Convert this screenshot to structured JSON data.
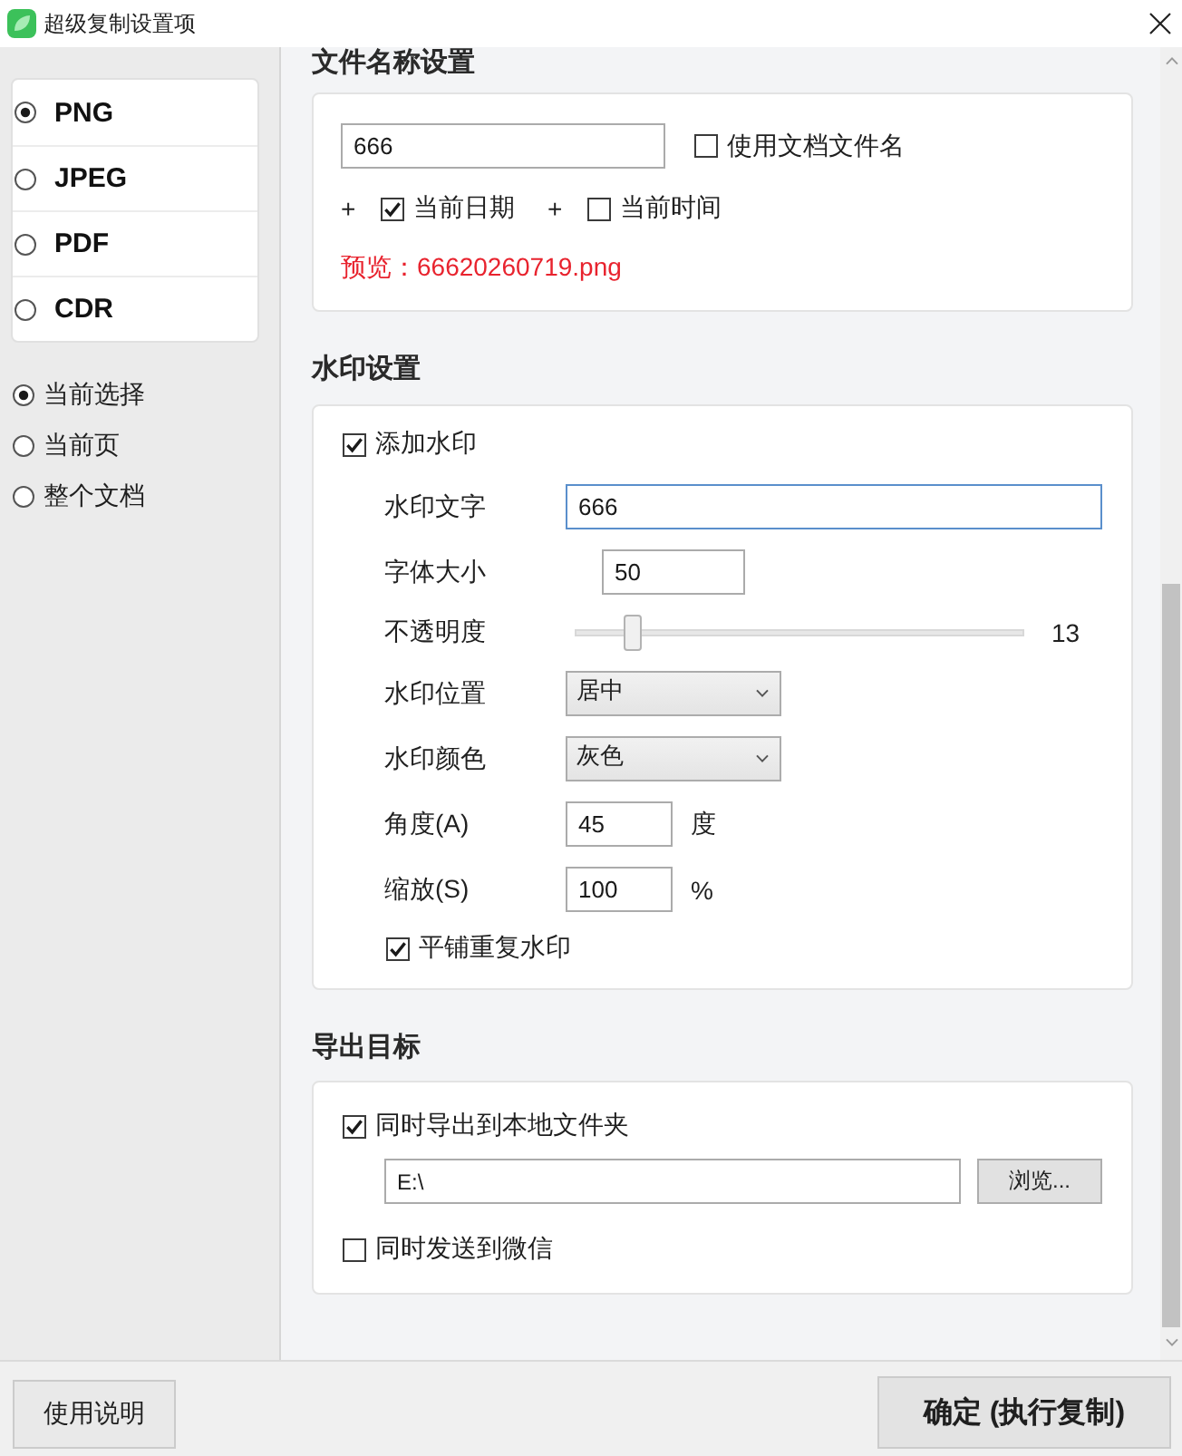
{
  "window": {
    "title": "超级复制设置项"
  },
  "formats": [
    {
      "label": "PNG",
      "selected": true
    },
    {
      "label": "JPEG",
      "selected": false
    },
    {
      "label": "PDF",
      "selected": false
    },
    {
      "label": "CDR",
      "selected": false
    }
  ],
  "ranges": [
    {
      "label": "当前选择",
      "selected": true
    },
    {
      "label": "当前页",
      "selected": false
    },
    {
      "label": "整个文档",
      "selected": false
    }
  ],
  "filename": {
    "title": "文件名称设置",
    "value": "666",
    "use_doc_name": {
      "label": "使用文档文件名",
      "checked": false
    },
    "suffixes": [
      {
        "plus": "+",
        "label": "当前日期",
        "checked": true
      },
      {
        "plus": "+",
        "label": "当前时间",
        "checked": false
      }
    ],
    "preview": "预览：66620260719.png"
  },
  "watermark": {
    "title": "水印设置",
    "enable": {
      "label": "添加水印",
      "checked": true
    },
    "fields": [
      {
        "kind": "text",
        "label": "水印文字",
        "value": "666",
        "focused": true
      },
      {
        "kind": "short",
        "label": "字体大小",
        "value": "50",
        "focused": false
      },
      {
        "kind": "slider",
        "label": "不透明度",
        "level": 0.13,
        "reading": "13"
      },
      {
        "kind": "dropdown",
        "label": "水印位置",
        "value": "居中"
      },
      {
        "kind": "dropdown",
        "label": "水印颜色",
        "value": "灰色"
      },
      {
        "kind": "unit",
        "label": "角度(A)",
        "value": "45",
        "unit": "度",
        "focused": false
      },
      {
        "kind": "unit",
        "label": "缩放(S)",
        "value": "100",
        "unit": "%",
        "focused": false
      }
    ],
    "tile": {
      "label": "平铺重复水印",
      "checked": true
    }
  },
  "export": {
    "title": "导出目标",
    "local": {
      "label": "同时导出到本地文件夹",
      "checked": true
    },
    "path": "E:\\",
    "browse": "浏览...",
    "wechat": {
      "label": "同时发送到微信",
      "checked": false
    }
  },
  "footer": {
    "help": "使用说明",
    "confirm": "确定 (执行复制)"
  }
}
